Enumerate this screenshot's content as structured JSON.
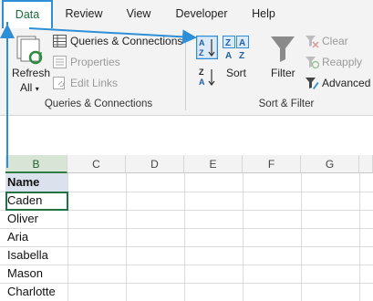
{
  "tabs": [
    {
      "label": "Data",
      "active": true
    },
    {
      "label": "Review"
    },
    {
      "label": "View"
    },
    {
      "label": "Developer"
    },
    {
      "label": "Help"
    }
  ],
  "ribbon": {
    "refresh_label": "Refresh",
    "refresh_all_label": "All",
    "queries_connections_label": "Queries & Connections",
    "properties_label": "Properties",
    "edit_links_label": "Edit Links",
    "group1_label": "Queries & Connections",
    "sort_label": "Sort",
    "filter_label": "Filter",
    "clear_label": "Clear",
    "reapply_label": "Reapply",
    "advanced_label": "Advanced",
    "group2_label": "Sort & Filter"
  },
  "grid": {
    "columns": [
      "B",
      "C",
      "D",
      "E",
      "F",
      "G"
    ],
    "rows": [
      "Name",
      "Caden",
      "Oliver",
      "Aria",
      "Isabella",
      "Mason",
      "Charlotte"
    ]
  },
  "colors": {
    "accent": "#2e8fd8",
    "excel_green": "#217346"
  }
}
